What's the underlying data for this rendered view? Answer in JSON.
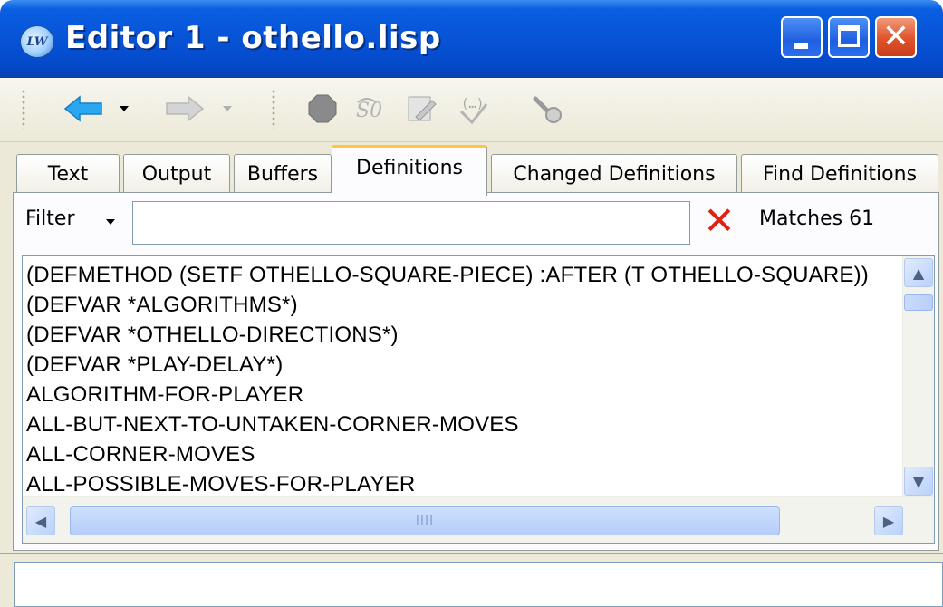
{
  "window": {
    "title": "Editor 1 - othello.lisp",
    "icon_label": "LW"
  },
  "title_buttons": {
    "minimize_icon": "minimize-icon",
    "maximize_icon": "maximize-icon",
    "close_icon": "close-icon",
    "close_glyph": "✕"
  },
  "toolbar": {
    "items": [
      "back-arrow-icon",
      "forward-arrow-icon",
      "stop-icon",
      "undo-icon",
      "edit-icon",
      "macro-icon",
      "tool-icon"
    ]
  },
  "tabs": [
    {
      "label": "Text"
    },
    {
      "label": "Output"
    },
    {
      "label": "Buffers"
    },
    {
      "label": "Definitions",
      "active": true
    },
    {
      "label": "Changed Definitions"
    },
    {
      "label": "Find Definitions"
    }
  ],
  "filter": {
    "label": "Filter",
    "value": "",
    "clear_glyph": "✕",
    "matches_text": "Matches 61"
  },
  "definitions": [
    "(DEFMETHOD (SETF OTHELLO-SQUARE-PIECE) :AFTER (T OTHELLO-SQUARE))",
    "(DEFVAR *ALGORITHMS*)",
    "(DEFVAR *OTHELLO-DIRECTIONS*)",
    "(DEFVAR *PLAY-DELAY*)",
    "ALGORITHM-FOR-PLAYER",
    "ALL-BUT-NEXT-TO-UNTAKEN-CORNER-MOVES",
    "ALL-CORNER-MOVES",
    "ALL-POSSIBLE-MOVES-FOR-PLAYER"
  ],
  "scrollbars": {
    "up": "▲",
    "down": "▼",
    "left": "◀",
    "right": "▶",
    "grip": "IIII"
  },
  "echo_area": {
    "value": ""
  },
  "colors": {
    "title_bar": "#0753d6",
    "active_tab_accent": "#ffc83c",
    "close_button": "#e0522a",
    "clear_x": "#e02010"
  }
}
